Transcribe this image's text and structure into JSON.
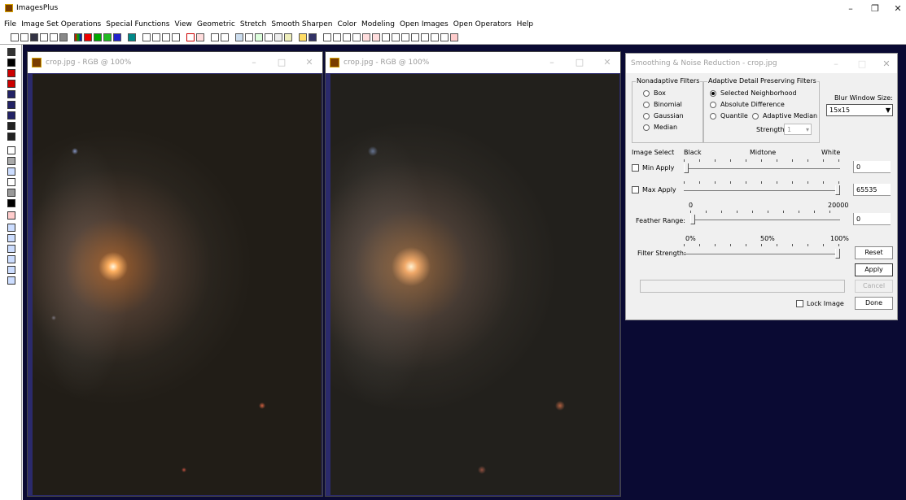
{
  "app": {
    "title": "ImagesPlus"
  },
  "window_controls": {
    "minimize": "–",
    "maximize": "❐",
    "close": "✕"
  },
  "menu": [
    "File",
    "Image Set Operations",
    "Special Functions",
    "View",
    "Geometric",
    "Stretch",
    "Smooth Sharpen",
    "Color",
    "Modeling",
    "Open Images",
    "Open Operators",
    "Help"
  ],
  "windows": [
    {
      "title": "crop.jpg - RGB @ 100%"
    },
    {
      "title": "crop.jpg - RGB @ 100%"
    }
  ],
  "dialog": {
    "title": "Smoothing & Noise Reduction - crop.jpg",
    "nonadaptive": {
      "legend": "Nonadaptive Filters",
      "options": [
        "Box",
        "Binomial",
        "Gaussian",
        "Median"
      ]
    },
    "adaptive": {
      "legend": "Adaptive Detail Preserving Filters",
      "selected": "Selected Neighborhood",
      "absolute": "Absolute Difference",
      "quantile": "Quantile",
      "median": "Adaptive Median",
      "strength_label": "Strength :",
      "strength_value": "1"
    },
    "blur": {
      "label": "Blur Window Size:",
      "value": "15x15"
    },
    "image_select": {
      "label": "Image Select",
      "black": "Black",
      "midtone": "Midtone",
      "white": "White"
    },
    "min_apply": {
      "label": "Min Apply",
      "value": "0",
      "level": 0
    },
    "max_apply": {
      "label": "Max Apply",
      "value": "65535",
      "level": 1
    },
    "feather": {
      "label": "Feather Range:",
      "min": "0",
      "max": "20000",
      "value": "0",
      "level": 0
    },
    "filter_strength": {
      "label": "Filter Strength:",
      "p0": "0%",
      "p50": "50%",
      "p100": "100%",
      "level": 1
    },
    "buttons": {
      "reset": "Reset",
      "apply": "Apply",
      "cancel": "Cancel",
      "done": "Done"
    },
    "lock_image": "Lock Image"
  }
}
